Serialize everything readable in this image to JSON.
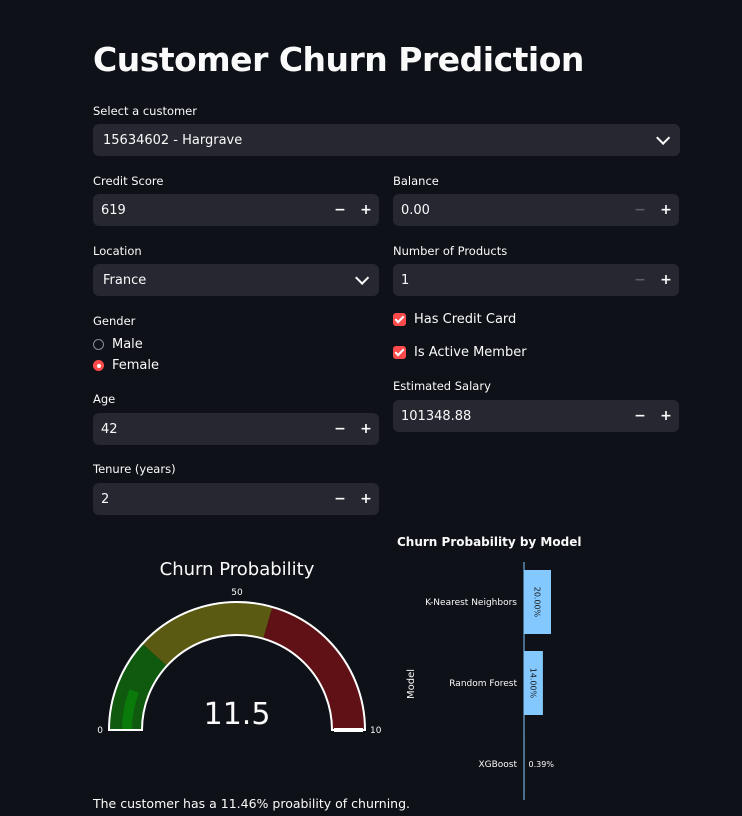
{
  "title": "Customer Churn Prediction",
  "customer_select": {
    "label": "Select a customer",
    "value": "15634602 - Hargrave"
  },
  "credit_score": {
    "label": "Credit Score",
    "value": "619"
  },
  "balance": {
    "label": "Balance",
    "value": "0.00"
  },
  "location": {
    "label": "Location",
    "value": "France"
  },
  "num_products": {
    "label": "Number of Products",
    "value": "1"
  },
  "gender": {
    "label": "Gender",
    "options": [
      "Male",
      "Female"
    ],
    "selected": "Female"
  },
  "has_credit_card": {
    "label": "Has Credit Card",
    "checked": true
  },
  "is_active_member": {
    "label": "Is Active Member",
    "checked": true
  },
  "estimated_salary": {
    "label": "Estimated Salary",
    "value": "101348.88"
  },
  "age": {
    "label": "Age",
    "value": "42"
  },
  "tenure": {
    "label": "Tenure (years)",
    "value": "2"
  },
  "buttons": {
    "minus": "−",
    "plus": "+"
  },
  "gauge": {
    "title": "Churn Probability",
    "value": 11.5,
    "value_label": "11.5",
    "min_label": "0",
    "mid_label": "50",
    "max_label": "10"
  },
  "chart_data": {
    "type": "bar",
    "title": "Churn Probability by Model",
    "ylabel": "Model",
    "xlabel": "",
    "categories": [
      "K-Nearest Neighbors",
      "Random Forest",
      "XGBoost"
    ],
    "values": [
      20.0,
      14.0,
      0.39
    ],
    "labels": [
      "20.00%",
      "14.00%",
      "0.39%"
    ],
    "bar_color": "#83c9ff"
  },
  "footer_text": "The customer has a 11.46% proability of churning.",
  "colors": {
    "accent": "#ff4b4b",
    "background": "#0e1117",
    "input_bg": "#262730"
  }
}
